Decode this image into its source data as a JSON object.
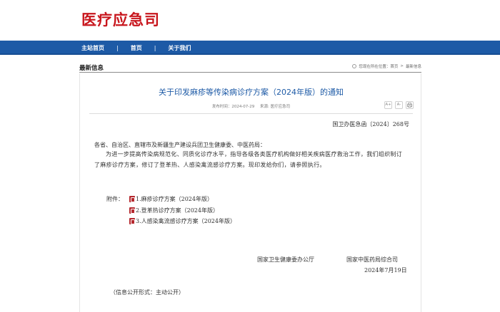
{
  "header": {
    "logo": "医疗应急司"
  },
  "nav": {
    "items": [
      "主站首页",
      "首页",
      "关于我们"
    ],
    "separator": "|"
  },
  "section": {
    "title": "最新信息",
    "breadcrumb": [
      "您现在所在位置：",
      "首页",
      "最新信息"
    ],
    "breadcrumb_sep": ">"
  },
  "article": {
    "title": "关于印发麻疹等传染病诊疗方案（2024年版）的通知",
    "published": "发布时间：2024-07-29",
    "source": "来源: 医疗应急司",
    "tools": [
      "A+",
      "A-",
      "print"
    ],
    "doc_number": "国卫办医急函〔2024〕268号",
    "addressee": "各省、自治区、直辖市及新疆生产建设兵团卫生健康委、中医药局：",
    "paragraph": "为进一步提高传染病规范化、同质化诊疗水平，指导各级各类医疗机构做好相关疾病医疗救治工作，我们组织制订了麻疹诊疗方案，修订了登革热、人感染禽流感诊疗方案。现印发给你们，请参照执行。",
    "attachments_label": "附件：",
    "attachments": [
      "1.麻疹诊疗方案（2024年版）",
      "2.登革热诊疗方案（2024年版）",
      "3.人感染禽流感诊疗方案（2024年版）"
    ],
    "signatory_1": "国家卫生健康委办公厅",
    "signatory_2": "国家中医药局综合司",
    "date": "2024年7月19日",
    "disclosure": "（信息公开形式：主动公开）"
  },
  "colors": {
    "brand_red": "#c8161d",
    "nav_blue": "#1d5aa6",
    "title_blue": "#1d5aa6"
  },
  "icons": {
    "location": "location-pin-icon",
    "pdf": "pdf-file-icon",
    "print": "print-icon"
  }
}
